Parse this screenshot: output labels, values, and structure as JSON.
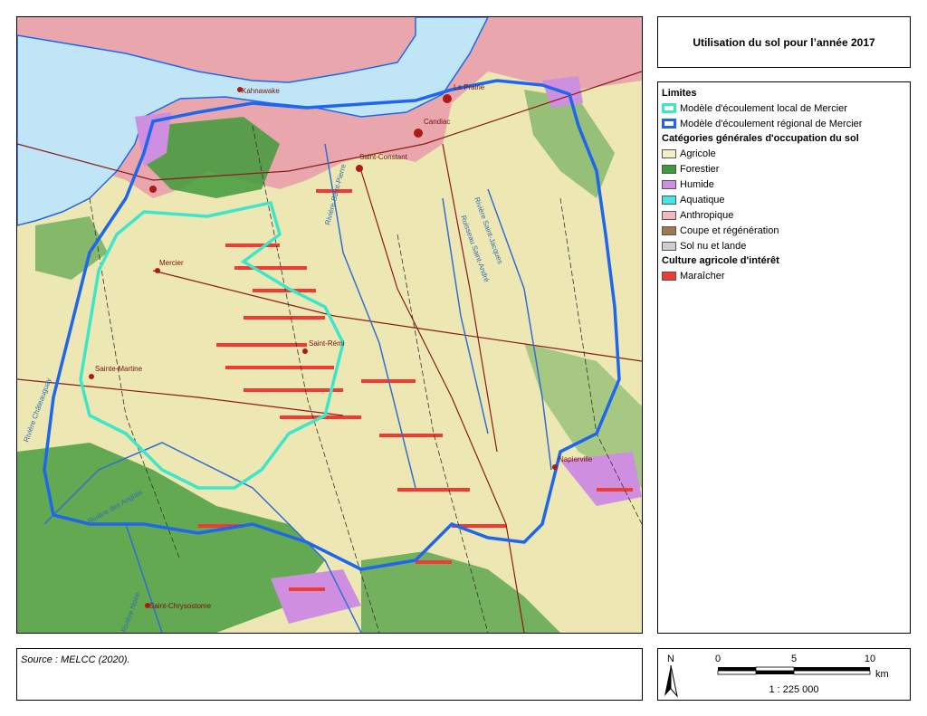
{
  "title": "Utilisation du sol pour l’année 2017",
  "legend": {
    "limits_heading": "Limites",
    "limits": [
      {
        "label": "Modèle d'écoulement local de Mercier",
        "color": "#3ee6c9"
      },
      {
        "label": "Modèle d'écoulement régional de Mercier",
        "color": "#1e66ee"
      }
    ],
    "categories_heading": "Catégories générales d'occupation du sol",
    "categories": [
      {
        "label": "Agricole",
        "color": "#f4f0c2"
      },
      {
        "label": "Forestier",
        "color": "#3f9a3a"
      },
      {
        "label": "Humide",
        "color": "#cf8fe0"
      },
      {
        "label": "Aquatique",
        "color": "#43e8e6"
      },
      {
        "label": "Anthropique",
        "color": "#f2b8bd"
      },
      {
        "label": "Coupe et régénération",
        "color": "#a07850"
      },
      {
        "label": "Sol nu et lande",
        "color": "#cfcfcf"
      }
    ],
    "interest_heading": "Culture agricole d'intérêt",
    "interest": [
      {
        "label": "Maraîcher",
        "color": "#f03a32"
      }
    ]
  },
  "places": {
    "kahnawake": "Kahnawake",
    "la_prairie": "La Prairie",
    "candiac": "Candiac",
    "saint_constant": "Saint-Constant",
    "mercier": "Mercier",
    "saint_remi": "Saint-Rémi",
    "sainte_martine": "Sainte-Martine",
    "napierville": "Napierville",
    "saint_chrysostome": "Saint-Chrysostome"
  },
  "rivers": {
    "chateauguay": "Rivière Châteauguay",
    "saint_pierre": "Rivière Saint-Pierre",
    "saint_andre": "Ruisseau Saint-André",
    "saint_jacques": "Rivière Saint-Jacques",
    "des_anglais": "Rivière des Anglais",
    "noire": "Rivière Noire"
  },
  "source": "Source : MELCC (2020).",
  "scale": {
    "north": "N",
    "ticks": [
      "0",
      "5",
      "10"
    ],
    "unit": "km",
    "ratio": "1 : 225 000"
  }
}
